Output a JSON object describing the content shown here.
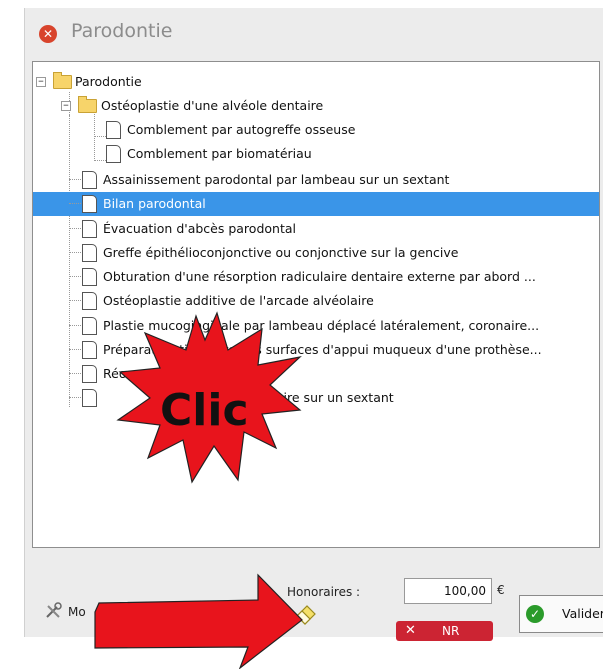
{
  "window": {
    "title": "Parodontie",
    "close_icon": "close-circle-icon",
    "accent_close": "#d8442c"
  },
  "tree": {
    "selection_color": "#3a95e8",
    "root": {
      "label": "Parodontie",
      "expander": "−"
    },
    "group": {
      "label": "Ostéoplastie d'une alvéole dentaire",
      "expander": "−"
    },
    "children": [
      "Comblement par autogreffe osseuse",
      "Comblement par biomatériau"
    ],
    "items": [
      "Assainissement parodontal par lambeau sur un sextant",
      "Bilan parodontal",
      "Évacuation d'abcès parodontal",
      "Greffe épithélioconjonctive ou conjonctive sur la gencive",
      "Obturation d'une résorption radiculaire dentaire externe par abord ...",
      "Ostéoplastie additive de l'arcade alvéolaire",
      "Plastie mucogingivale par lambeau déplacé latéralement, coronaire...",
      "Préparation tissulaire des surfaces d'appui muqueux d'une prothèse...",
      "Réo",
      "",
      "taire sur un sextant"
    ],
    "selected_item_index": 1
  },
  "footer": {
    "honoraires_label": "Honoraires :",
    "amount": "100,00",
    "currency": "€",
    "validate_label": "Valider",
    "nr_label": "NR",
    "nr_color": "#cc2433",
    "mod_label": "Mo",
    "eraser_icon": "eraser-icon"
  },
  "annotation": {
    "burst_text": "Clic",
    "burst_color": "#e8141c",
    "arrow_color": "#e8141c"
  }
}
